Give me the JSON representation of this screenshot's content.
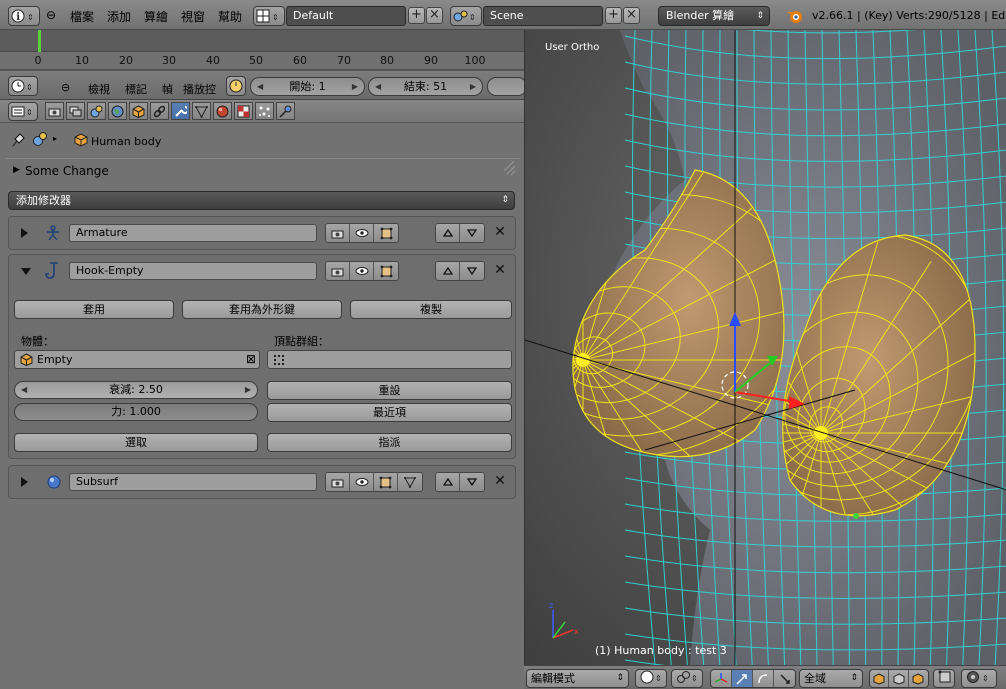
{
  "topbar": {
    "menus": [
      "檔案",
      "添加",
      "算繪",
      "視窗",
      "幫助"
    ],
    "screen_layout": "Default",
    "scene": "Scene",
    "render_engine": "Blender 算繪",
    "stats": "v2.66.1 | (Key) Verts:290/5128 | Edge"
  },
  "timeline": {
    "ticks": [
      "0",
      "10",
      "20",
      "30",
      "40",
      "50",
      "60",
      "70",
      "80",
      "90",
      "100"
    ],
    "menus": [
      "檢視",
      "標記",
      "幀",
      "播放控"
    ],
    "start_label": "開始: 1",
    "end_label": "結束: 51"
  },
  "breadcrumb": {
    "object_name": "Human body"
  },
  "panel_collapsed": "Some Change",
  "add_modifier_label": "添加修改器",
  "modifiers": {
    "armature": {
      "name": "Armature"
    },
    "hook": {
      "name": "Hook-Empty",
      "apply_label": "套用",
      "apply_shape_label": "套用為外形鍵",
      "copy_label": "複製",
      "object_label": "物體：",
      "vgroup_label": "頂點群組：",
      "object_value": "Empty",
      "falloff_label": "衰減: 2.50",
      "force_label": "力: 1.000",
      "reset_label": "重設",
      "recenter_label": "最近項",
      "select_label": "選取",
      "assign_label": "指派"
    },
    "subsurf": {
      "name": "Subsurf"
    }
  },
  "viewport": {
    "view_label": "User Ortho",
    "object_info": "(1) Human body : test 3",
    "mode": "編輯模式",
    "pivot_global": "全域",
    "colors": {
      "wire": "#2fd6d6",
      "selected": "#f0e21a",
      "skin": "#b08a62",
      "body": "#7a7c86"
    }
  }
}
